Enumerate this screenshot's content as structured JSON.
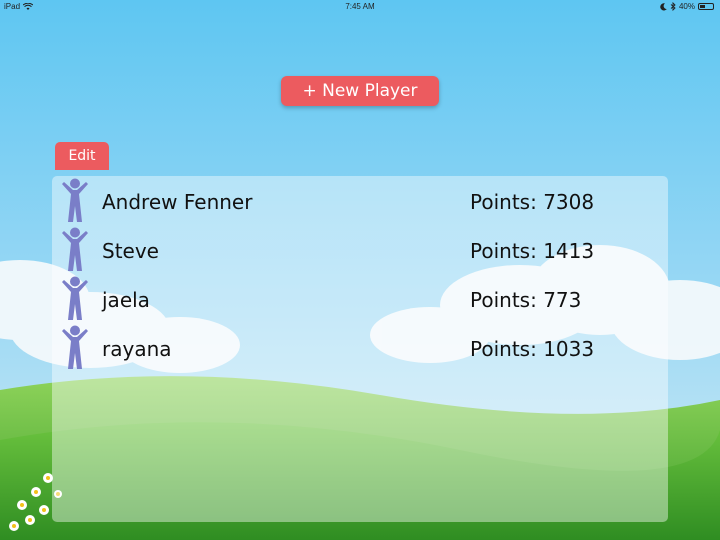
{
  "status_bar": {
    "device": "iPad",
    "time": "7:45 AM",
    "battery": "40%",
    "battery_level": 0.4,
    "icons": [
      "wifi-icon",
      "moon-icon",
      "bluetooth-icon",
      "battery-icon"
    ]
  },
  "new_player_button": {
    "label": "+ New Player"
  },
  "edit_button": {
    "label": "Edit"
  },
  "players": [
    {
      "name": "Andrew Fenner",
      "points_label": "Points:",
      "points": "7308"
    },
    {
      "name": "Steve",
      "points_label": "Points:",
      "points": "1413"
    },
    {
      "name": "jaela",
      "points_label": "Points:",
      "points": "773"
    },
    {
      "name": "rayana",
      "points_label": "Points:",
      "points": "1033"
    }
  ],
  "colors": {
    "sky_top": "#5ec6f2",
    "sky_bottom": "#bfe6f7",
    "grass": "#3ea52e",
    "button": "#ec5b5f",
    "avatar": "#7a7ec8"
  }
}
